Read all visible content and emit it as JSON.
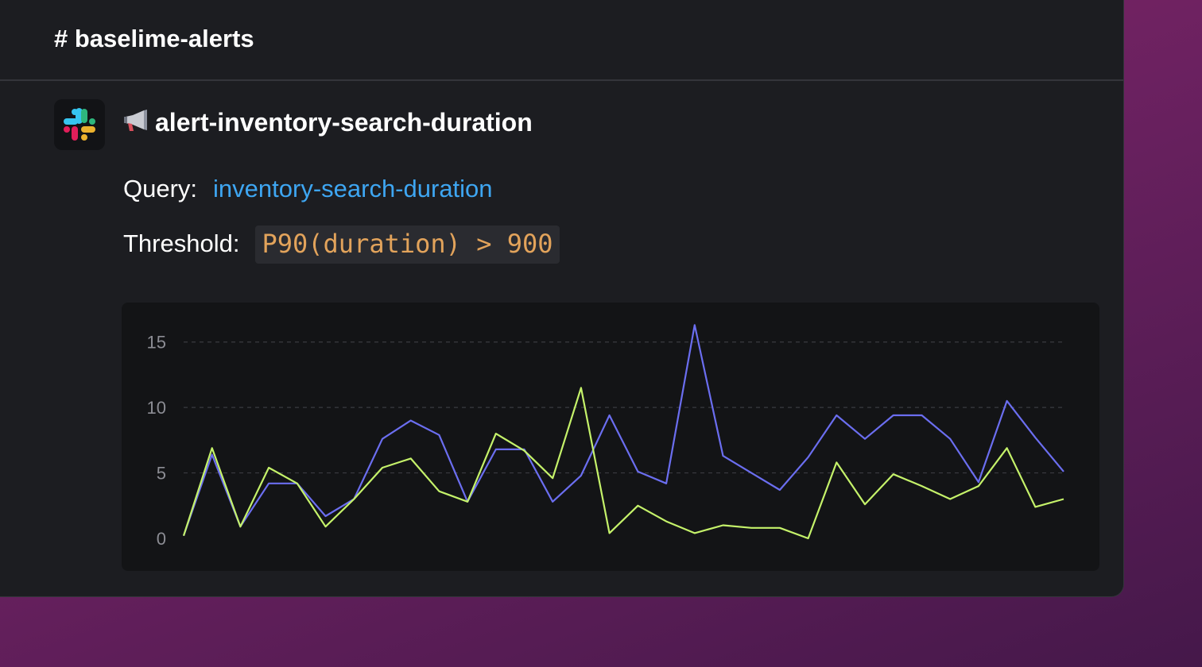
{
  "channel": {
    "name": "# baselime-alerts"
  },
  "message": {
    "icon": "slack-logo-icon",
    "alert_icon": "megaphone-icon",
    "alert_name": "alert-inventory-search-duration",
    "query_label": "Query:",
    "query_value": "inventory-search-duration",
    "threshold_label": "Threshold:",
    "threshold_value": "P90(duration) > 900"
  },
  "colors": {
    "series_blue": "#6b6ef0",
    "series_green": "#c5f26a",
    "link": "#3ea6f2",
    "code": "#e2a35b"
  },
  "chart_data": {
    "type": "line",
    "ylim": [
      0,
      16.5
    ],
    "yticks": [
      "15",
      "10",
      "5",
      "0"
    ],
    "ytick_values": [
      15,
      10,
      5,
      0
    ],
    "grid": true,
    "xlabel": "",
    "ylabel": "",
    "x": [
      0,
      1,
      2,
      3,
      4,
      5,
      6,
      7,
      8,
      9,
      10,
      11,
      12,
      13,
      14,
      15,
      16,
      17,
      18,
      19,
      20,
      21,
      22,
      23,
      24,
      25,
      26,
      27,
      28,
      29,
      30,
      31
    ],
    "series": [
      {
        "color": "#6b6ef0",
        "values": [
          0.2,
          6.4,
          0.9,
          4.2,
          4.2,
          1.7,
          3.0,
          7.6,
          9.0,
          7.9,
          2.8,
          6.8,
          6.8,
          2.8,
          4.8,
          9.4,
          5.1,
          4.2,
          16.3,
          6.3,
          5.0,
          3.7,
          6.2,
          9.4,
          7.6,
          9.4,
          9.4,
          7.6,
          4.3,
          10.5,
          7.7,
          5.1
        ]
      },
      {
        "color": "#c5f26a",
        "values": [
          0.2,
          6.9,
          0.9,
          5.4,
          4.2,
          0.9,
          3.0,
          5.4,
          6.1,
          3.6,
          2.8,
          8.0,
          6.7,
          4.6,
          11.5,
          0.4,
          2.5,
          1.3,
          0.4,
          1.0,
          0.8,
          0.8,
          0.0,
          5.8,
          2.6,
          4.9,
          4.0,
          3.0,
          4.0,
          6.9,
          2.4,
          3.0
        ]
      }
    ]
  }
}
